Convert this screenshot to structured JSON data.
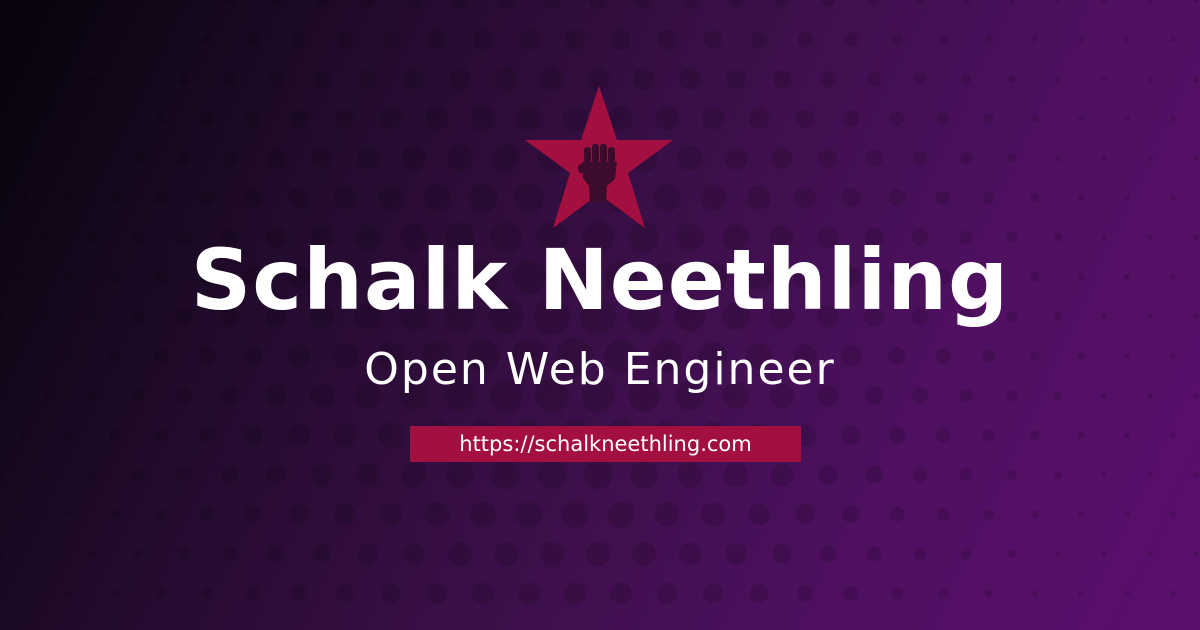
{
  "profile": {
    "name": "Schalk Neethling",
    "role": "Open Web Engineer",
    "url": "https://schalkneethling.com"
  },
  "logo": {
    "icon": "star-raised-fist-icon",
    "star_color": "#a3103f",
    "fist_color": "#3c0c2c"
  },
  "colors": {
    "background_start": "#07030b",
    "background_end": "#5b0f6e",
    "accent": "#a3103f",
    "text": "#ffffff"
  }
}
